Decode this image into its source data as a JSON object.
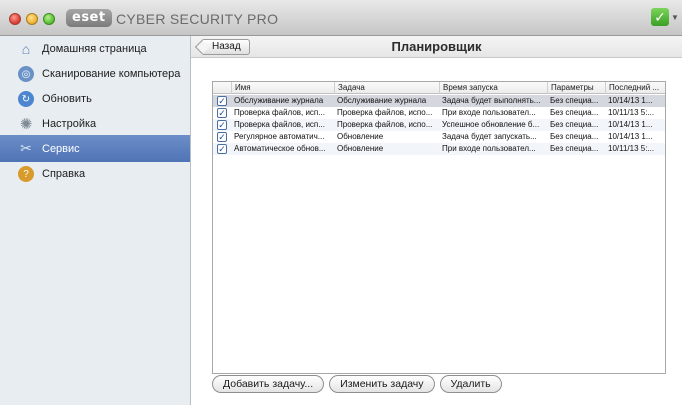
{
  "window": {
    "app_title": "CYBER SECURITY PRO",
    "logo_text": "eset",
    "status_icon": "check-icon",
    "status_color": "#4caf30"
  },
  "sidebar": {
    "items": [
      {
        "label": "Домашняя страница",
        "icon": "home-icon",
        "active": false
      },
      {
        "label": "Сканирование компьютера",
        "icon": "scan-icon",
        "active": false
      },
      {
        "label": "Обновить",
        "icon": "update-icon",
        "active": false
      },
      {
        "label": "Настройка",
        "icon": "setup-icon",
        "active": false
      },
      {
        "label": "Сервис",
        "icon": "tools-icon",
        "active": true
      },
      {
        "label": "Справка",
        "icon": "help-icon",
        "active": false
      }
    ]
  },
  "header": {
    "back_label": "Назад",
    "title": "Планировщик"
  },
  "table": {
    "columns": [
      "Имя",
      "Задача",
      "Время запуска",
      "Параметры",
      "Последний ..."
    ],
    "rows": [
      {
        "checked": true,
        "selected": true,
        "cells": [
          "Обслуживание журнала",
          "Обслуживание журнала",
          "Задача будет выполнять...",
          "Без специа...",
          "10/14/13 1..."
        ]
      },
      {
        "checked": true,
        "selected": false,
        "cells": [
          "Проверка файлов, исп...",
          "Проверка файлов, испо...",
          "При входе пользовател...",
          "Без специа...",
          "10/11/13 5:..."
        ]
      },
      {
        "checked": true,
        "selected": false,
        "cells": [
          "Проверка файлов, исп...",
          "Проверка файлов, испо...",
          "Успешное обновление б...",
          "Без специа...",
          "10/14/13 1..."
        ]
      },
      {
        "checked": true,
        "selected": false,
        "cells": [
          "Регулярное автоматич...",
          "Обновление",
          "Задача будет запускать...",
          "Без специа...",
          "10/14/13 1..."
        ]
      },
      {
        "checked": true,
        "selected": false,
        "cells": [
          "Автоматическое обнов...",
          "Обновление",
          "При входе пользовател...",
          "Без специа...",
          "10/11/13 5:..."
        ]
      }
    ]
  },
  "buttons": {
    "add": "Добавить задачу...",
    "edit": "Изменить задачу",
    "delete": "Удалить"
  }
}
